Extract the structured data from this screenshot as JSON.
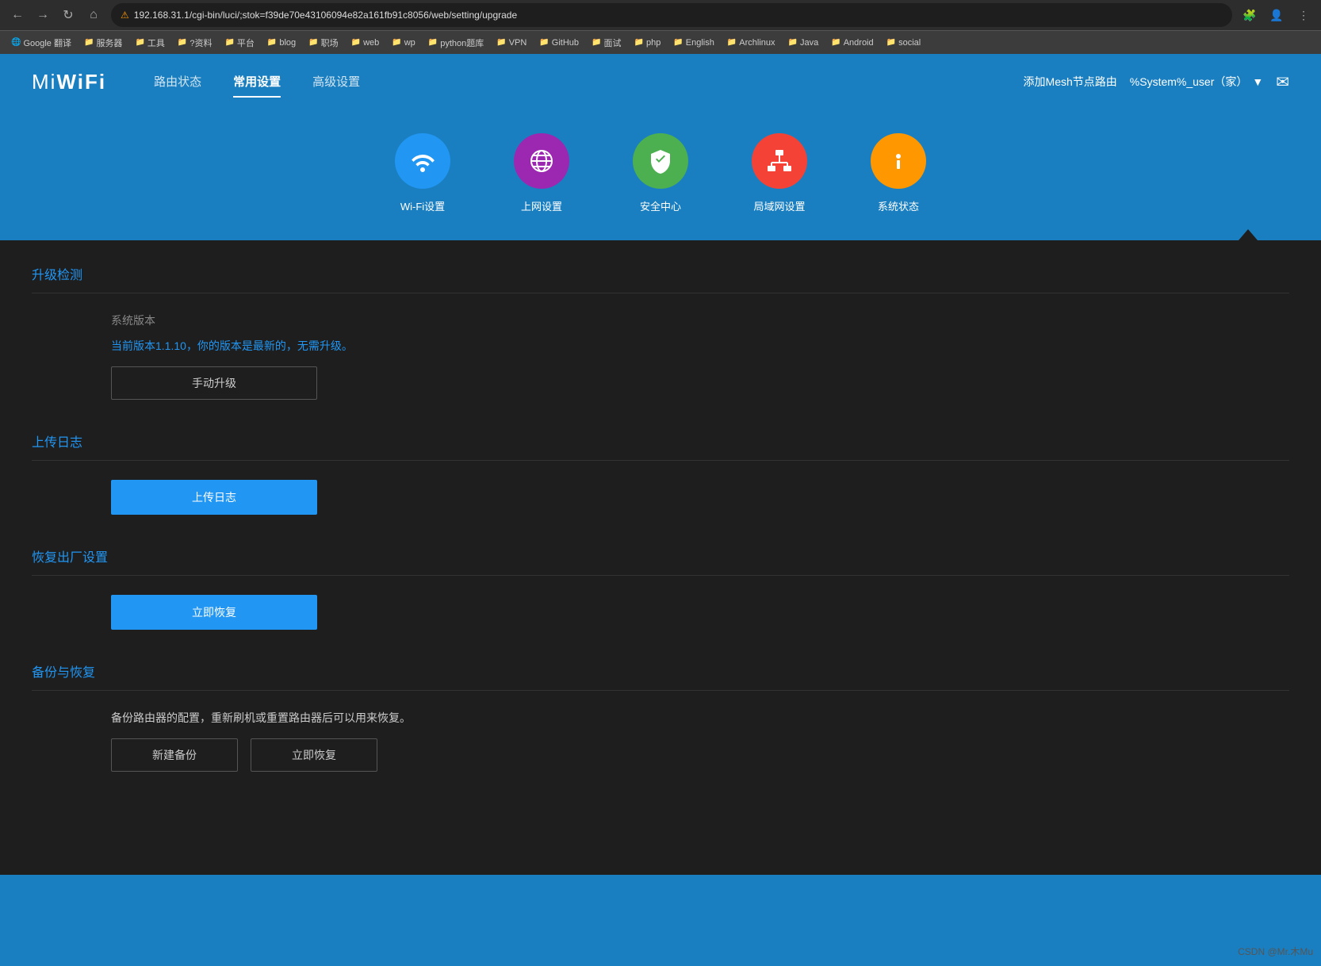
{
  "browser": {
    "url": "192.168.31.1/cgi-bin/luci/;stok=f39de70e43106094e82a161fb91c8056/web/setting/upgrade",
    "lock_label": "Not secure",
    "bookmarks": [
      {
        "label": "Google 翻译",
        "icon": "🌐"
      },
      {
        "label": "服务器",
        "icon": "📁"
      },
      {
        "label": "工具",
        "icon": "📁"
      },
      {
        "label": "?资料",
        "icon": "📁"
      },
      {
        "label": "平台",
        "icon": "📁"
      },
      {
        "label": "blog",
        "icon": "📁"
      },
      {
        "label": "职场",
        "icon": "📁"
      },
      {
        "label": "web",
        "icon": "📁"
      },
      {
        "label": "wp",
        "icon": "📁"
      },
      {
        "label": "python题库",
        "icon": "📁"
      },
      {
        "label": "VPN",
        "icon": "📁"
      },
      {
        "label": "GitHub",
        "icon": "📁"
      },
      {
        "label": "面试",
        "icon": "📁"
      },
      {
        "label": "php",
        "icon": "📁"
      },
      {
        "label": "English",
        "icon": "📁"
      },
      {
        "label": "Archlinux",
        "icon": "📁"
      },
      {
        "label": "Java",
        "icon": "📁"
      },
      {
        "label": "Android",
        "icon": "📁"
      },
      {
        "label": "social",
        "icon": "📁"
      }
    ]
  },
  "app": {
    "logo": "MiWiFi",
    "nav": {
      "items": [
        {
          "label": "路由状态",
          "active": false
        },
        {
          "label": "常用设置",
          "active": true
        },
        {
          "label": "高级设置",
          "active": false
        }
      ]
    },
    "add_mesh": "添加Mesh节点路由",
    "user": "%System%_user（家）",
    "icons": [
      {
        "label": "Wi-Fi设置",
        "color": "blue",
        "icon": "📶"
      },
      {
        "label": "上网设置",
        "color": "purple",
        "icon": "🌐"
      },
      {
        "label": "安全中心",
        "color": "green",
        "icon": "🛡"
      },
      {
        "label": "局域网设置",
        "color": "orange",
        "icon": "🔀"
      },
      {
        "label": "系统状态",
        "color": "amber",
        "icon": "ℹ"
      }
    ]
  },
  "sections": {
    "upgrade": {
      "title": "升级检测",
      "version_label": "系统版本",
      "version_text_prefix": "当前版本",
      "version_number": "1.1.10",
      "version_text_suffix": "，你的版本是最新的，无需升级。",
      "manual_upgrade_btn": "手动升级"
    },
    "upload_log": {
      "title": "上传日志",
      "btn_label": "上传日志"
    },
    "factory_reset": {
      "title": "恢复出厂设置",
      "btn_label": "立即恢复"
    },
    "backup_restore": {
      "title": "备份与恢复",
      "description": "备份路由器的配置，重新刷机或重置路由器后可以用来恢复。",
      "new_backup_btn": "新建备份",
      "restore_btn": "立即恢复"
    }
  },
  "watermark": "CSDN @Mr.木Mu"
}
